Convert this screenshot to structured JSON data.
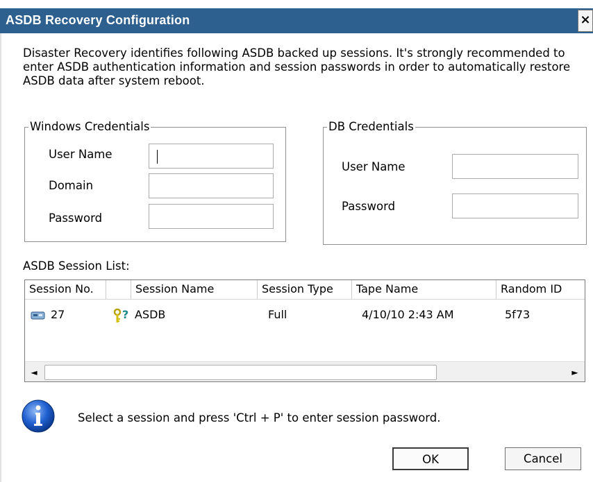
{
  "window": {
    "title": "ASDB Recovery Configuration",
    "close_glyph": "×"
  },
  "intro_text": "Disaster Recovery identifies following ASDB backed up sessions. It's strongly recommended to enter ASDB authentication information and session passwords in order to automatically restore ASDB data after system reboot.",
  "windows_credentials": {
    "legend": "Windows Credentials",
    "user_name_label": "User Name",
    "domain_label": "Domain",
    "password_label": "Password",
    "user_name_value": "",
    "domain_value": "",
    "password_value": ""
  },
  "db_credentials": {
    "legend": "DB Credentials",
    "user_name_label": "User Name",
    "password_label": "Password",
    "user_name_value": "",
    "password_value": ""
  },
  "session_list": {
    "label": "ASDB Session List:",
    "columns": [
      "Session No.",
      "",
      "Session Name",
      "Session Type",
      "Tape Name",
      "Random ID"
    ],
    "rows": [
      {
        "session_no": "27",
        "key_mark": "?",
        "session_name": "ASDB",
        "session_type": "Full",
        "tape_name": "4/10/10 2:43 AM",
        "random_id": "5f73"
      }
    ],
    "scroll_left_glyph": "◄",
    "scroll_right_glyph": "►"
  },
  "info": {
    "icon": "information-icon",
    "message": "Select a session and press 'Ctrl + P' to enter session password."
  },
  "buttons": {
    "ok": "OK",
    "cancel": "Cancel"
  },
  "colors": {
    "title_bar": "#2d5f8f",
    "info_blue": "#1f5fcf"
  }
}
